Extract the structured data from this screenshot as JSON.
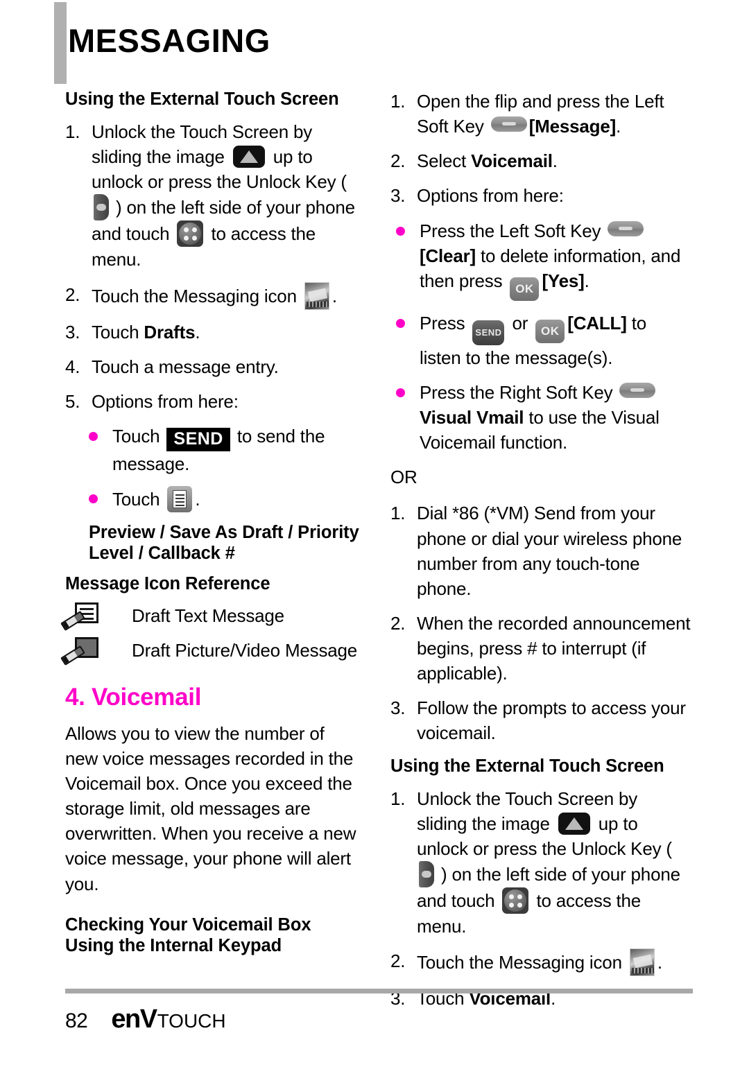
{
  "header": {
    "title": "MESSAGING"
  },
  "left": {
    "section_heading": "Using the External Touch Screen",
    "steps": [
      {
        "n": "1.",
        "pre": "Unlock the Touch Screen by sliding the image ",
        "mid": " up to unlock or press the Unlock Key ( ",
        "mid2": " ) on the left side of your phone and touch ",
        "post": " to access the menu."
      },
      {
        "n": "2.",
        "pre": "Touch the Messaging icon ",
        "post": "."
      },
      {
        "n": "3.",
        "pre": "Touch ",
        "bold": "Drafts",
        "post": "."
      },
      {
        "n": "4.",
        "pre": "Touch a message entry."
      },
      {
        "n": "5.",
        "pre": "Options from here:"
      }
    ],
    "bullets": [
      {
        "pre": "Touch ",
        "tag": "SEND",
        "post": " to send the message."
      },
      {
        "pre": "Touch ",
        "post": "."
      }
    ],
    "options_heading": "Preview / Save As Draft / Priority Level / Callback #",
    "icon_reference_heading": "Message Icon Reference",
    "icon_reference": [
      {
        "icon": "draft-text-message-icon",
        "label": "Draft Text Message"
      },
      {
        "icon": "draft-picture-video-message-icon",
        "label": "Draft Picture/Video Message"
      }
    ],
    "voicemail_heading": "4. Voicemail",
    "voicemail_paragraph": "Allows you to view the number of new voice messages recorded in the Voicemail box. Once you exceed the storage limit, old messages are overwritten. When you receive a new voice message, your phone will alert you.",
    "checking_heading_line1": "Checking Your Voicemail Box",
    "checking_heading_line2": "Using the Internal Keypad"
  },
  "right": {
    "steps_top": [
      {
        "n": "1.",
        "pre": "Open the flip and press the Left Soft Key ",
        "bold": "[Message]",
        "post": "."
      },
      {
        "n": "2.",
        "pre": "Select ",
        "bold": "Voicemail",
        "post": "."
      },
      {
        "n": "3.",
        "pre": "Options from here:"
      }
    ],
    "bullets": [
      {
        "pre": "Press the Left Soft Key ",
        "bold1": "[Clear]",
        "mid": " to delete information, and then press ",
        "bold2": "[Yes]",
        "post": "."
      },
      {
        "pre": "Press ",
        "mid": " or ",
        "bold": "[CALL]",
        "post": " to listen to the message(s)."
      },
      {
        "pre": " Press the Right Soft Key ",
        "bold": "Visual Vmail",
        "post": " to use the Visual Voicemail function."
      }
    ],
    "or_label": "OR",
    "steps_or": [
      {
        "n": "1.",
        "text": "Dial *86 (*VM) Send from your phone or dial your wireless phone number from any touch-tone phone."
      },
      {
        "n": "2.",
        "text": "When the recorded announcement begins, press # to interrupt (if applicable)."
      },
      {
        "n": "3.",
        "text": "Follow the prompts to access your voicemail."
      }
    ],
    "section_heading": "Using the External Touch Screen",
    "steps_bottom": [
      {
        "n": "1.",
        "pre": "Unlock the Touch Screen by sliding the image ",
        "mid": " up to unlock or press the Unlock Key ( ",
        "mid2": " ) on the left side of your phone and touch ",
        "post": " to access the menu."
      },
      {
        "n": "2.",
        "pre": "Touch the Messaging icon ",
        "post": "."
      },
      {
        "n": "3.",
        "pre": "Touch ",
        "bold": "Voicemail",
        "post": "."
      }
    ]
  },
  "keys": {
    "ok_label": "OK",
    "send_label": "SEND"
  },
  "footer": {
    "page_number": "82",
    "brand_env": "enV",
    "brand_touch": "TOUCH"
  },
  "colors": {
    "accent_pink": "#ff00c8",
    "rule_gray": "#a8a8a8",
    "header_bar_gray": "#b0b0b0"
  }
}
